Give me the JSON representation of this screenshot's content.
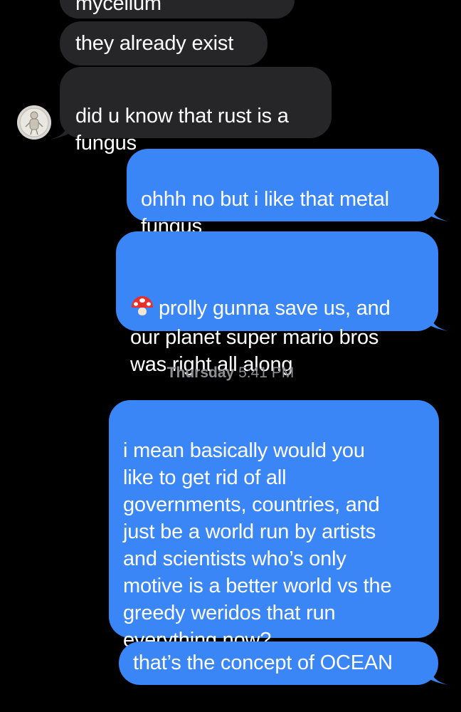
{
  "conversation": {
    "messages": [
      {
        "id": "m0",
        "direction": "incoming",
        "text": "mycelium"
      },
      {
        "id": "m1",
        "direction": "incoming",
        "text": "they already exist"
      },
      {
        "id": "m2",
        "direction": "incoming",
        "text": "did u know that rust is a\nfungus"
      },
      {
        "id": "m3",
        "direction": "outgoing",
        "text": "ohhh no but i like that metal\nfungus"
      },
      {
        "id": "m4",
        "direction": "outgoing",
        "emoji": "mushroom-icon",
        "text": "prolly gunna save us, and\nour planet super mario bros\nwas right all along"
      },
      {
        "id": "m5",
        "direction": "outgoing",
        "text": "i mean basically would you\nlike to get rid of all\ngovernments, countries, and\njust be a world run by artists\nand scientists who’s only\nmotive is a better world vs the\ngreedy weridos that run\neverything now?"
      },
      {
        "id": "m6",
        "direction": "outgoing",
        "text": "that’s the concept of OCEAN"
      }
    ],
    "timestamp": {
      "day": "Thursday",
      "time": "5:41 PM"
    }
  },
  "colors": {
    "background": "#000000",
    "incoming_bubble": "#262628",
    "outgoing_bubble": "#3a86f7",
    "timestamp": "#8e8e93"
  },
  "icons": {
    "avatar": "contact-avatar",
    "emoji": "mushroom-icon"
  }
}
